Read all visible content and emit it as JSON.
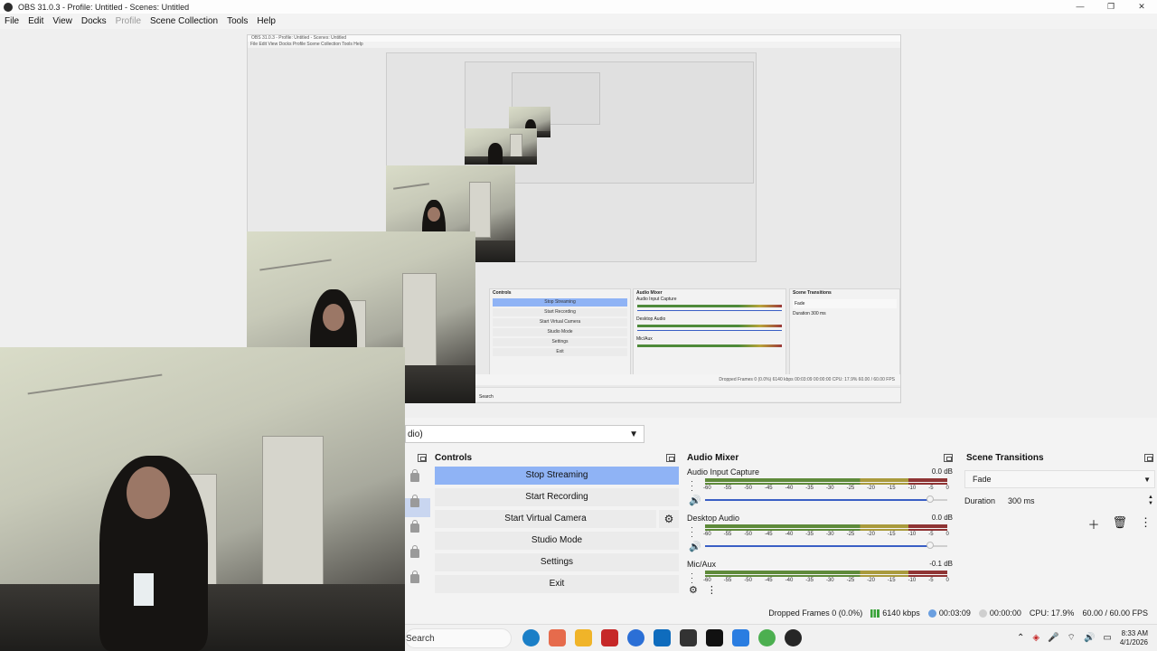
{
  "window": {
    "title": "OBS 31.0.3 - Profile: Untitled - Scenes: Untitled",
    "minimize": "—",
    "maximize": "❐",
    "close": "✕"
  },
  "menu": {
    "items": [
      "File",
      "Edit",
      "View",
      "Docks",
      "Profile",
      "Scene Collection",
      "Tools",
      "Help"
    ]
  },
  "preview": {
    "nested_title": "OBS 31.0.3 - Profile: Untitled - Scenes: Untitled",
    "nested_menu": "File  Edit  View  Docks  Profile  Scene Collection  Tools  Help",
    "nested_controls": [
      "Stop Streaming",
      "Start Recording",
      "Start Virtual Camera",
      "Studio Mode",
      "Settings",
      "Exit"
    ],
    "nested_mixer_title": "Audio Mixer",
    "nested_mixer_channels": [
      "Audio Input Capture",
      "Desktop Audio",
      "Mic/Aux"
    ],
    "nested_controls_title": "Controls",
    "nested_transitions_title": "Scene Transitions",
    "nested_transition": "Fade",
    "nested_duration": "Duration   300 ms",
    "nested_status": "Dropped Frames 0 (0.0%)   6140 kbps   00:03:09   00:00:00   CPU: 17.9%   60.00 / 60.00 FPS",
    "nested_search": "Search"
  },
  "scene_select": {
    "value": "dio)"
  },
  "controls": {
    "title": "Controls",
    "stop_streaming": "Stop Streaming",
    "start_recording": "Start Recording",
    "start_virtual_camera": "Start Virtual Camera",
    "studio_mode": "Studio Mode",
    "settings": "Settings",
    "exit": "Exit"
  },
  "mixer": {
    "title": "Audio Mixer",
    "ticks": [
      "-60",
      "-55",
      "-50",
      "-45",
      "-40",
      "-35",
      "-30",
      "-25",
      "-20",
      "-15",
      "-10",
      "-5",
      "0"
    ],
    "channels": [
      {
        "name": "Audio Input Capture",
        "db": "0.0 dB",
        "volume": 0.98
      },
      {
        "name": "Desktop Audio",
        "db": "0.0 dB",
        "volume": 0.98
      },
      {
        "name": "Mic/Aux",
        "db": "-0.1 dB",
        "volume": 0.98
      }
    ]
  },
  "transitions": {
    "title": "Scene Transitions",
    "transition": "Fade",
    "duration_label": "Duration",
    "duration_value": "300 ms"
  },
  "status": {
    "dropped": "Dropped Frames 0 (0.0%)",
    "bitrate": "6140 kbps",
    "stream_time": "00:03:09",
    "rec_time": "00:00:00",
    "cpu": "CPU: 17.9%",
    "fps": "60.00 / 60.00 FPS"
  },
  "taskbar": {
    "search": "Search",
    "time": "8:33 AM",
    "date": "4/1/2026"
  },
  "colors": {
    "accent": "#8fb3f5",
    "selected_row": "#c9d6f0",
    "slider": "#3a5fc5"
  }
}
